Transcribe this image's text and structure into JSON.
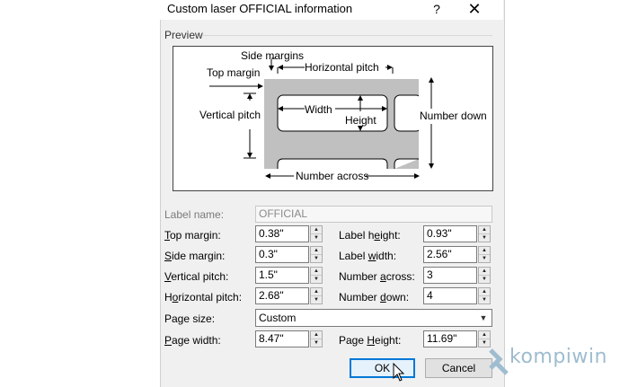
{
  "window": {
    "title": "Custom laser OFFICIAL information",
    "help_glyph": "?",
    "close_glyph": "✕"
  },
  "preview": {
    "group_label": "Preview",
    "labels": {
      "side_margins": "Side margins",
      "top_margin": "Top margin",
      "horizontal_pitch": "Horizontal pitch",
      "vertical_pitch": "Vertical pitch",
      "width": "Width",
      "height": "Height",
      "number_down": "Number down",
      "number_across": "Number across"
    }
  },
  "form": {
    "label_name": {
      "label": "Label name:",
      "value": "OFFICIAL"
    },
    "top_margin": {
      "label_pre": "",
      "label_u": "T",
      "label_post": "op margin:",
      "value": "0.38\""
    },
    "side_margin": {
      "label_pre": "",
      "label_u": "S",
      "label_post": "ide margin:",
      "value": "0.3\""
    },
    "vertical_pitch": {
      "label_pre": "",
      "label_u": "V",
      "label_post": "ertical pitch:",
      "value": "1.5\""
    },
    "horizontal_pitch": {
      "label_pre": "H",
      "label_u": "o",
      "label_post": "rizontal pitch:",
      "value": "2.68\""
    },
    "label_height": {
      "label_pre": "Label h",
      "label_u": "e",
      "label_post": "ight:",
      "value": "0.93\""
    },
    "label_width": {
      "label_pre": "Label ",
      "label_u": "w",
      "label_post": "idth:",
      "value": "2.56\""
    },
    "number_across": {
      "label_pre": "Number ",
      "label_u": "a",
      "label_post": "cross:",
      "value": "3"
    },
    "number_down": {
      "label_pre": "Number ",
      "label_u": "d",
      "label_post": "own:",
      "value": "4"
    },
    "page_size": {
      "label": "Page size:",
      "value": "Custom"
    },
    "page_width": {
      "label_pre": "",
      "label_u": "P",
      "label_post": "age width:",
      "value": "8.47\""
    },
    "page_height": {
      "label_pre": "Page ",
      "label_u": "H",
      "label_post": "eight:",
      "value": "11.69\""
    }
  },
  "buttons": {
    "ok": "OK",
    "cancel": "Cancel"
  },
  "watermark": {
    "text": "kompiwin"
  }
}
